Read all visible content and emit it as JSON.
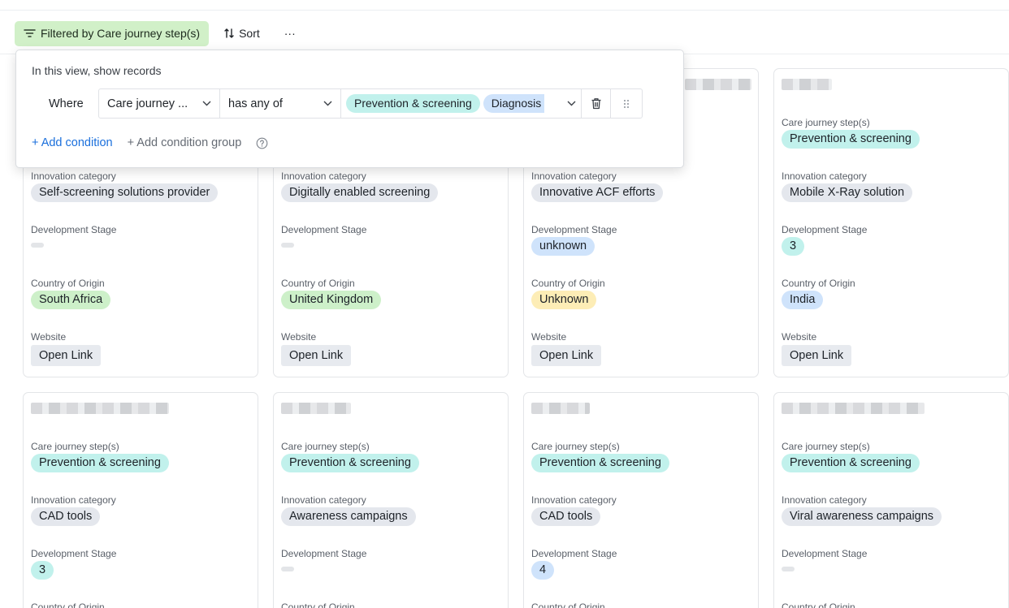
{
  "toolbar": {
    "filter_label": "Filtered by Care journey step(s)",
    "sort_label": "Sort",
    "more_label": "···"
  },
  "filter_popover": {
    "title": "In this view, show records",
    "where_label": "Where",
    "field": "Care journey ...",
    "operator": "has any of",
    "values": [
      "Prevention & screening",
      "Diagnosis"
    ],
    "add_condition": "+ Add condition",
    "add_condition_group": "+ Add condition group"
  },
  "field_labels": {
    "care_journey": "Care journey step(s)",
    "innovation": "Innovation category",
    "stage": "Development Stage",
    "country": "Country of Origin",
    "website": "Website"
  },
  "row1": [
    {
      "innovation": "Self-screening solutions provider",
      "stage": "",
      "country": "South Africa",
      "country_color": "green",
      "website": "Open Link"
    },
    {
      "innovation": "Digitally enabled screening",
      "stage": "",
      "country": "United Kingdom",
      "country_color": "green",
      "website": "Open Link"
    },
    {
      "innovation": "Innovative ACF efforts",
      "stage": "unknown",
      "stage_color": "blue",
      "country": "Unknown",
      "country_color": "yellow",
      "website": "Open Link"
    },
    {
      "care_journey": "Prevention & screening",
      "innovation": "Mobile X-Ray solution",
      "stage": "3",
      "stage_color": "teal",
      "country": "India",
      "country_color": "blue",
      "website": "Open Link"
    }
  ],
  "row2": [
    {
      "care_journey": "Prevention & screening",
      "innovation": "CAD tools",
      "stage": "3",
      "stage_color": "teal",
      "country_label": "Country of Origin"
    },
    {
      "care_journey": "Prevention & screening",
      "innovation": "Awareness campaigns",
      "stage": "",
      "country_label": "Country of Origin"
    },
    {
      "care_journey": "Prevention & screening",
      "innovation": "CAD tools",
      "stage": "4",
      "stage_color": "blue",
      "country_label": "Country of Origin"
    },
    {
      "care_journey": "Prevention & screening",
      "innovation": "Viral awareness campaigns",
      "stage": "",
      "country_label": "Country of Origin"
    }
  ],
  "colors": {
    "filter_button_bg": "#d1f0c8",
    "teal_chip": "#c1f1ec",
    "gray_chip": "#e4e7ed",
    "blue_chip": "#cfe3fb",
    "green_chip": "#cdf0c9",
    "yellow_chip": "#fdedb6",
    "link_accent": "#1a6fdc"
  },
  "icons": [
    "filter-icon",
    "sort-icon",
    "more-icon",
    "chevron-down-icon",
    "trash-icon",
    "drag-handle-icon",
    "help-circle-icon"
  ]
}
